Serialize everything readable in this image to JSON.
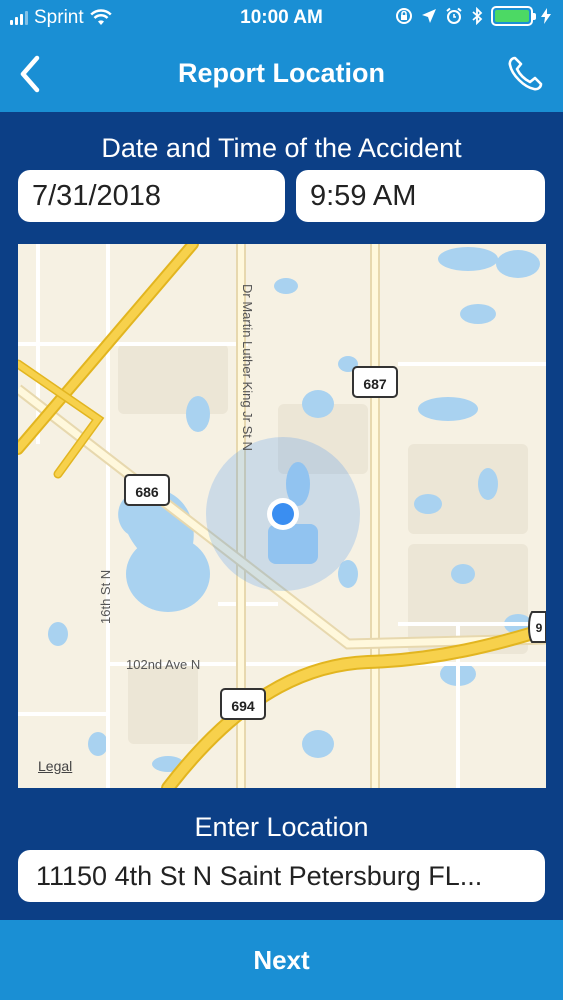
{
  "status_bar": {
    "carrier": "Sprint",
    "time": "10:00 AM"
  },
  "nav": {
    "title": "Report Location"
  },
  "date_time": {
    "label": "Date and Time of the Accident",
    "date": "7/31/2018",
    "time": "9:59 AM"
  },
  "map": {
    "legal": "Legal",
    "street_labels": {
      "mlk": "Dr Martin Luther King Jr St N",
      "street_16th": "16th St N",
      "ave_102nd": "102nd Ave N"
    },
    "shields": {
      "r686": "686",
      "r687": "687",
      "r694": "694",
      "r9": "9"
    }
  },
  "location": {
    "label": "Enter Location",
    "value": "11150 4th St N Saint Petersburg FL..."
  },
  "footer": {
    "next_label": "Next"
  },
  "colors": {
    "primary": "#1a8fd4",
    "background": "#0c3f86",
    "water": "#a9d2f0",
    "highway": "#f7d14c",
    "user_dot": "#3a8ef1"
  }
}
